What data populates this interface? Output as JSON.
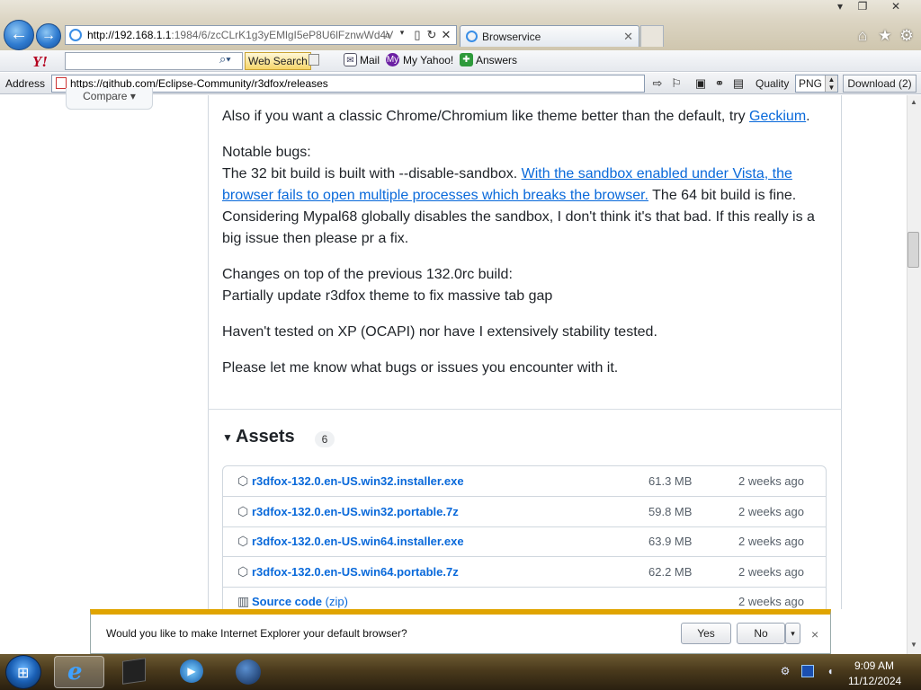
{
  "browser": {
    "address_url": "http://192.168.1.1:1984/6/zcCLrK1g3yEMlgI5eP8U6lFznwWd4V",
    "address_host": "http://192.168.1.1",
    "address_rest": ":1984/6/zcCLrK1g3yEMlgI5eP8U6lFznwWd4V",
    "tab_title": "Browservice",
    "window_controls": [
      "▾",
      "❐",
      "✕"
    ],
    "right_tools": [
      "⌂",
      "★",
      "⚙"
    ]
  },
  "yahoo_toolbar": {
    "logo": "Y!",
    "search_button": "Web Search",
    "links": [
      "Mail",
      "My Yahoo!",
      "Answers"
    ],
    "link_icon_labels": [
      "",
      "My",
      ""
    ]
  },
  "address_bar": {
    "label": "Address",
    "url": "https://github.com/Eclipse-Community/r3dfox/releases",
    "quality_label": "Quality",
    "quality_value": "PNG",
    "download_label": "Download (2)"
  },
  "page": {
    "compare_label": "Compare",
    "para1_text": "Also if you want a classic Chrome/Chromium like theme better than the default, try ",
    "para1_link": "Geckium",
    "para1_end": ".",
    "bugs_heading": "Notable bugs:",
    "bugs_text1": "The 32 bit build is built with --disable-sandbox. ",
    "bugs_link": "With the sandbox enabled under Vista, the browser fails to open multiple processes which breaks the browser.",
    "bugs_text2": " The 64 bit build is fine. Considering Mypal68 globally disables the sandbox, I don't think it's that bad. If this really is a big issue then please pr a fix.",
    "changes_heading": "Changes on top of the previous 132.0rc build:",
    "changes_text": "Partially update r3dfox theme to fix massive tab gap",
    "untested_text": "Haven't tested on XP (OCAPI) nor have I extensively stability tested.",
    "feedback_text": "Please let me know what bugs or issues you encounter with it.",
    "assets_title": "Assets",
    "assets_count": "6",
    "assets": [
      {
        "name": "r3dfox-132.0.en-US.win32.installer.exe",
        "size": "61.3 MB",
        "date": "2 weeks ago",
        "icon": "package-icon"
      },
      {
        "name": "r3dfox-132.0.en-US.win32.portable.7z",
        "size": "59.8 MB",
        "date": "2 weeks ago",
        "icon": "package-icon"
      },
      {
        "name": "r3dfox-132.0.en-US.win64.installer.exe",
        "size": "63.9 MB",
        "date": "2 weeks ago",
        "icon": "package-icon"
      },
      {
        "name": "r3dfox-132.0.en-US.win64.portable.7z",
        "size": "62.2 MB",
        "date": "2 weeks ago",
        "icon": "package-icon"
      },
      {
        "name": "Source code",
        "sub": "(zip)",
        "size": "",
        "date": "2 weeks ago",
        "icon": "file-zip-icon"
      }
    ]
  },
  "notification": {
    "text": "Would you like to make Internet Explorer your default browser?",
    "yes_label": "Yes",
    "no_label": "No",
    "dropdown_glyph": "▾",
    "close_glyph": "×"
  },
  "taskbar": {
    "time": "9:09 AM",
    "date": "11/12/2024",
    "start_glyph": "⊞",
    "ie_glyph": "e",
    "media_glyph": "▶"
  },
  "colors": {
    "link": "#0969da",
    "notify_border": "#e0a400",
    "yahoo": "#b4001e"
  }
}
